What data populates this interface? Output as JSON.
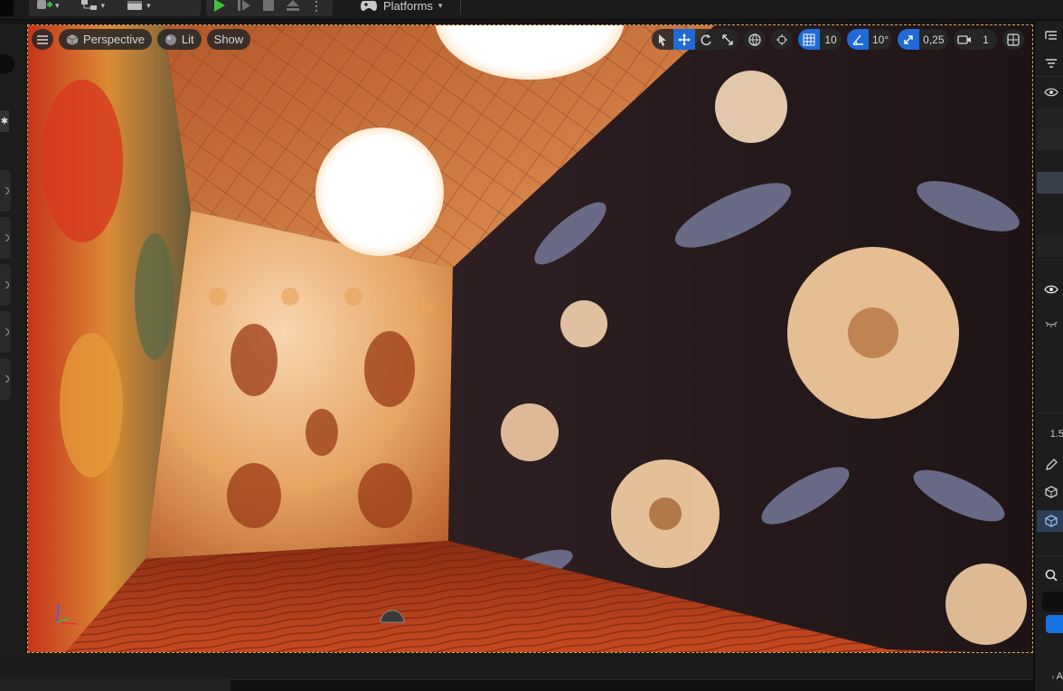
{
  "toolbar": {
    "platforms_label": "Platforms",
    "icons": [
      "add-actor-icon",
      "blueprint-icon",
      "cinematics-icon",
      "play-icon",
      "advance-frame-icon",
      "stop-icon",
      "eject-icon",
      "more-icon",
      "controller-icon"
    ]
  },
  "viewport": {
    "menu_icon": "hamburger-icon",
    "perspective_label": "Perspective",
    "lit_label": "Lit",
    "show_label": "Show",
    "grid_snap_value": "10",
    "rotation_snap_value": "10°",
    "scale_snap_value": "0,25",
    "camera_speed_value": "1",
    "transform_tools": [
      "select-icon",
      "translate-icon",
      "rotate-icon",
      "scale-icon"
    ],
    "colors": {
      "accent": "#1f6ad6",
      "selection_border": "#d4a15a"
    }
  },
  "details_panel": {
    "partial_value": "1.5",
    "partial_letter": "A"
  }
}
